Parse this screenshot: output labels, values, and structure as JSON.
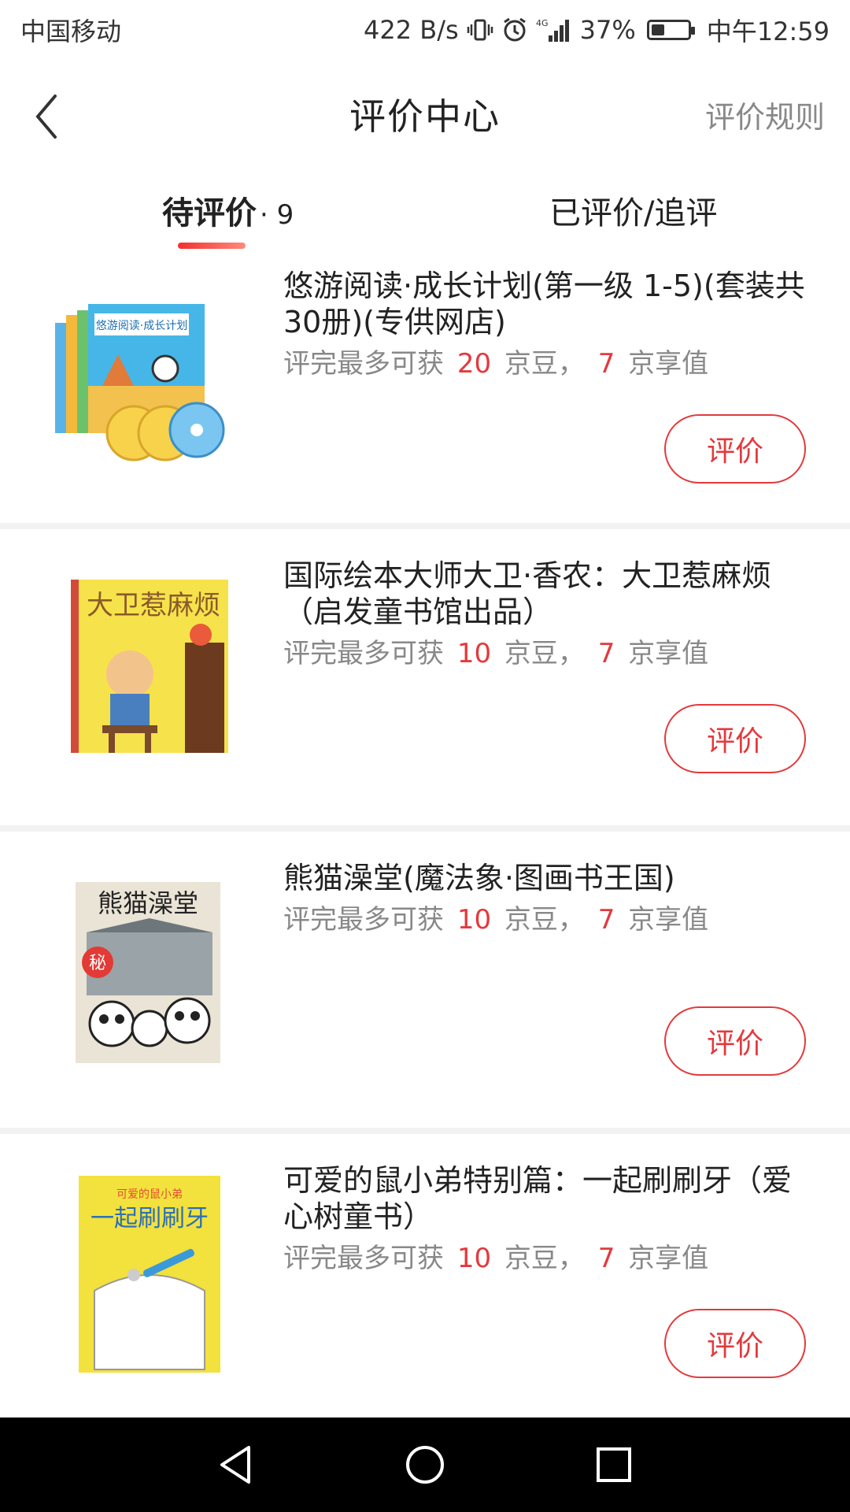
{
  "status_bar": {
    "carrier": "中国移动",
    "speed": "422 B/s",
    "battery_percent": "37%",
    "battery_level": 0.37,
    "time": "中午12:59"
  },
  "header": {
    "title": "评价中心",
    "rules_link": "评价规则"
  },
  "tabs": {
    "pending_label": "待评价",
    "pending_count": "· 9",
    "reviewed_label": "已评价/追评"
  },
  "reward_text": {
    "prefix": "评完最多可获",
    "jingdou": "京豆，",
    "jingxiang": "京享值"
  },
  "products": [
    {
      "title": "悠游阅读·成长计划(第一级 1-5)(套装共30册)(专供网店)",
      "jingdou": "20",
      "jingxiang": "7",
      "button": "评价"
    },
    {
      "title": "国际绘本大师大卫·香农：大卫惹麻烦（启发童书馆出品）",
      "jingdou": "10",
      "jingxiang": "7",
      "button": "评价"
    },
    {
      "title": "熊猫澡堂(魔法象·图画书王国)",
      "jingdou": "10",
      "jingxiang": "7",
      "button": "评价"
    },
    {
      "title": "可爱的鼠小弟特别篇：一起刷刷牙（爱心树童书）",
      "jingdou": "10",
      "jingxiang": "7",
      "button": "评价"
    }
  ],
  "covers": {
    "c1": "悠游阅读·成长计划",
    "c2": "大卫惹麻烦",
    "c3": "熊猫澡堂",
    "c3_badge": "秘",
    "c4_top": "可爱的鼠小弟",
    "c4": "一起刷刷牙"
  },
  "colors": {
    "accent": "#e4393c",
    "text": "#222222",
    "muted": "#888888",
    "divider": "#f2f2f2"
  }
}
